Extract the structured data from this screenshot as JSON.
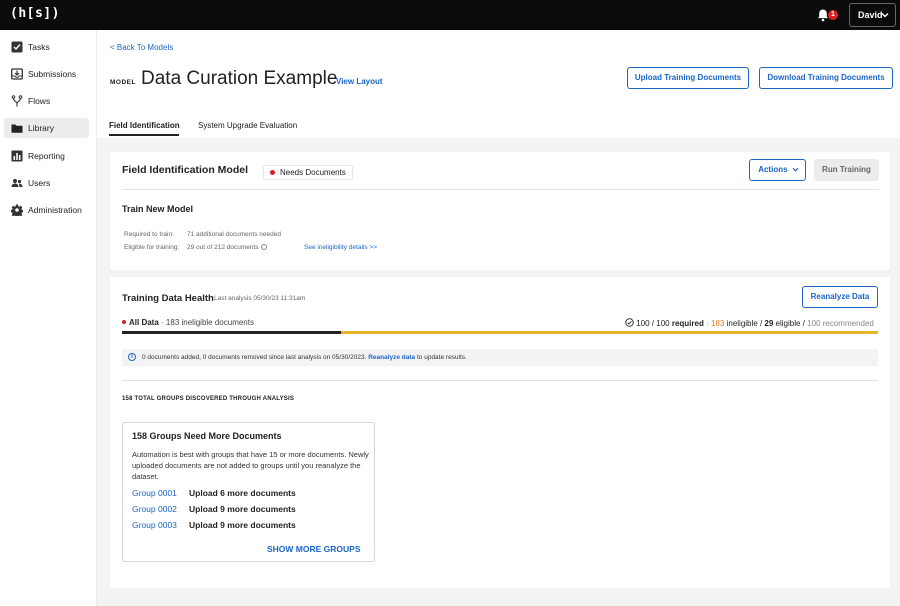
{
  "app": {
    "logo": "(h[s])",
    "notification_count": "1",
    "user_name": "David"
  },
  "sidebar": {
    "items": [
      {
        "label": "Tasks",
        "icon": "checkbox-icon"
      },
      {
        "label": "Submissions",
        "icon": "inbox-icon"
      },
      {
        "label": "Flows",
        "icon": "flow-icon"
      },
      {
        "label": "Library",
        "icon": "folder-icon",
        "active": true
      },
      {
        "label": "Reporting",
        "icon": "bar-chart-icon"
      },
      {
        "label": "Users",
        "icon": "users-icon"
      },
      {
        "label": "Administration",
        "icon": "gear-icon"
      }
    ]
  },
  "header": {
    "back_link": "< Back To Models",
    "model_tag": "MODEL",
    "title": "Data Curation Example",
    "view_layout": "View Layout",
    "upload_button": "Upload Training Documents",
    "download_button": "Download Training Documents"
  },
  "tabs": [
    {
      "label": "Field Identification",
      "active": true
    },
    {
      "label": "System Upgrade Evaluation",
      "active": false
    }
  ],
  "field_model": {
    "title": "Field Identification Model",
    "status": "Needs Documents",
    "actions_button": "Actions",
    "run_training_button": "Run Training",
    "train_title": "Train New Model",
    "required_label": "Required to train:",
    "required_value": "71 additional documents needed",
    "eligible_label": "Eligible for training:",
    "eligible_value": "29 out of 212 documents",
    "ineligibility_link": "See ineligibility details >>"
  },
  "health": {
    "title": "Training Data Health",
    "last_analysis": "Last analysis 05/30/23 11:31am",
    "reanalyze_button": "Reanalyze Data",
    "all_data_label": "All Data",
    "ineligible_text": "· 183 ineligible documents",
    "required_count": "100 / 100",
    "required_word": "required",
    "sep1": "·",
    "ineligible_count": "183",
    "ineligible_word": "ineligible /",
    "eligible_count": "29",
    "eligible_word": "eligible /",
    "recommended": "100 recommended",
    "progress_fraction": 0.29,
    "banner_text": "0 documents added, 0 documents removed since last analysis on 05/30/2023.",
    "banner_link": "Reanalyze data",
    "banner_suffix": "to update results.",
    "groups_heading": "158 TOTAL GROUPS DISCOVERED THROUGH ANALYSIS",
    "groups_card_title": "158 Groups Need More Documents",
    "groups_desc": "Automation is best with groups that have 15 or more documents. Newly uploaded documents are not added to groups until you reanalyze the dataset.",
    "groups": [
      {
        "name": "Group 0001",
        "message": "Upload 6 more documents"
      },
      {
        "name": "Group 0002",
        "message": "Upload 9 more documents"
      },
      {
        "name": "Group 0003",
        "message": "Upload 9 more documents"
      }
    ],
    "show_more": "SHOW MORE GROUPS"
  },
  "colors": {
    "accent": "#1a66c9",
    "status_red": "#d32020",
    "warning": "#e2771b",
    "progress_track": "#e5b62a"
  }
}
